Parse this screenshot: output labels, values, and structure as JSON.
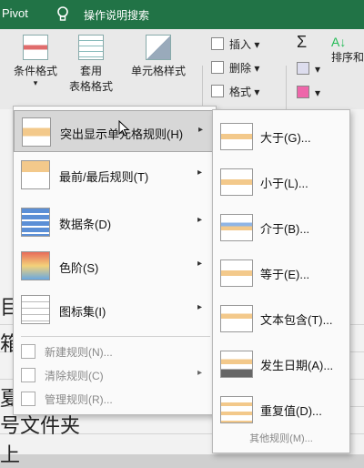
{
  "titlebar": {
    "pivot": "Pivot",
    "search": "操作说明搜索"
  },
  "ribbon": {
    "cond_format": "条件格式",
    "table_format_1": "套用",
    "table_format_2": "表格格式",
    "cell_style": "单元格样式",
    "insert": "插入",
    "delete": "删除",
    "format": "格式",
    "sum": "Σ",
    "sort": "排序和"
  },
  "sheet": {
    "row1": "目",
    "row2": "箱",
    "row3": "夏",
    "row4": "号文件夹",
    "row5": "上"
  },
  "menu": {
    "items": [
      {
        "label": "突出显示单元格规则(H)",
        "arrow": "▸"
      },
      {
        "label": "最前/最后规则(T)",
        "arrow": "▸"
      },
      {
        "label": "数据条(D)",
        "arrow": "▸"
      },
      {
        "label": "色阶(S)",
        "arrow": "▸"
      },
      {
        "label": "图标集(I)",
        "arrow": "▸"
      }
    ],
    "extra": [
      {
        "label": "新建规则(N)..."
      },
      {
        "label": "清除规则(C)",
        "arrow": "▸"
      },
      {
        "label": "管理规则(R)..."
      }
    ]
  },
  "submenu": {
    "items": [
      {
        "label": "大于(G)..."
      },
      {
        "label": "小于(L)..."
      },
      {
        "label": "介于(B)..."
      },
      {
        "label": "等于(E)..."
      },
      {
        "label": "文本包含(T)..."
      },
      {
        "label": "发生日期(A)..."
      },
      {
        "label": "重复值(D)..."
      }
    ],
    "more": "其他规则(M)..."
  },
  "colors": {
    "titlebar": "#217346",
    "highlight": "#d7d7d7"
  }
}
